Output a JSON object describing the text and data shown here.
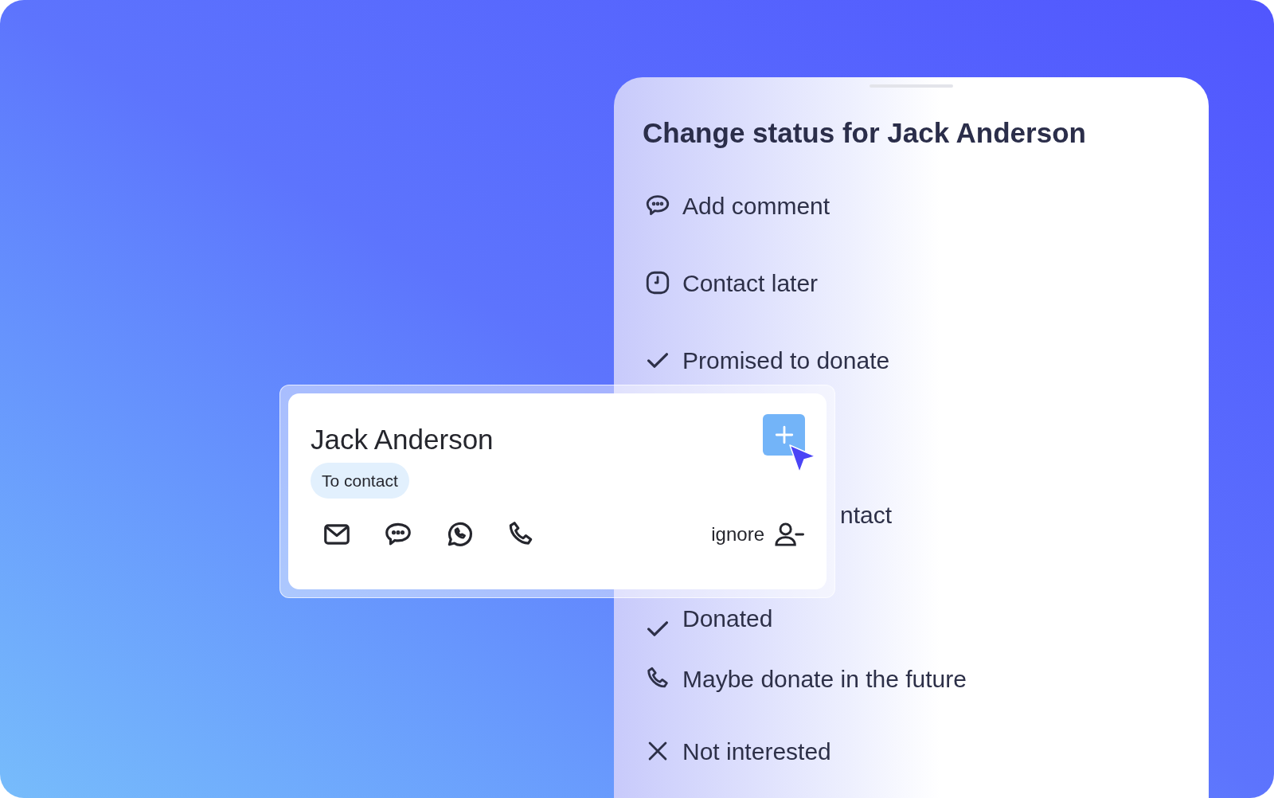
{
  "status_panel": {
    "title": "Change status for Jack Anderson",
    "items": [
      {
        "kind": "comment",
        "label": "Add comment"
      },
      {
        "kind": "clock",
        "label": "Contact later"
      },
      {
        "kind": "check",
        "label": "Promised to donate"
      },
      {
        "kind": "clipped",
        "label": "ntact"
      },
      {
        "kind": "check",
        "label": "Donated"
      },
      {
        "kind": "phone",
        "label": "Maybe donate in the future"
      },
      {
        "kind": "cross",
        "label": "Not interested"
      }
    ]
  },
  "contact_card": {
    "name": "Jack Anderson",
    "badge": "To contact",
    "actions": [
      {
        "kind": "mail"
      },
      {
        "kind": "chat"
      },
      {
        "kind": "whatsapp"
      },
      {
        "kind": "phone"
      }
    ],
    "ignore": "ignore"
  }
}
